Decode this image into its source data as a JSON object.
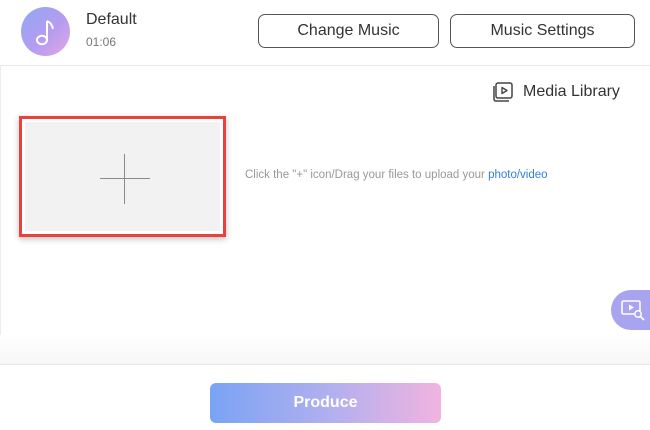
{
  "track": {
    "title": "Default",
    "duration": "01:06",
    "icon": "music-note-icon"
  },
  "header": {
    "change_music_label": "Change Music",
    "music_settings_label": "Music Settings"
  },
  "media_library": {
    "label": "Media Library",
    "icon": "media-library-icon"
  },
  "upload": {
    "icon": "plus-icon",
    "hint_prefix": "Click the \"+\" icon/Drag your files to upload your ",
    "hint_link": "photo/video",
    "accent_color": "#2f7fe0",
    "highlight_color": "#e8423c"
  },
  "side_tool": {
    "icon": "video-search-icon"
  },
  "footer": {
    "produce_label": "Produce"
  }
}
